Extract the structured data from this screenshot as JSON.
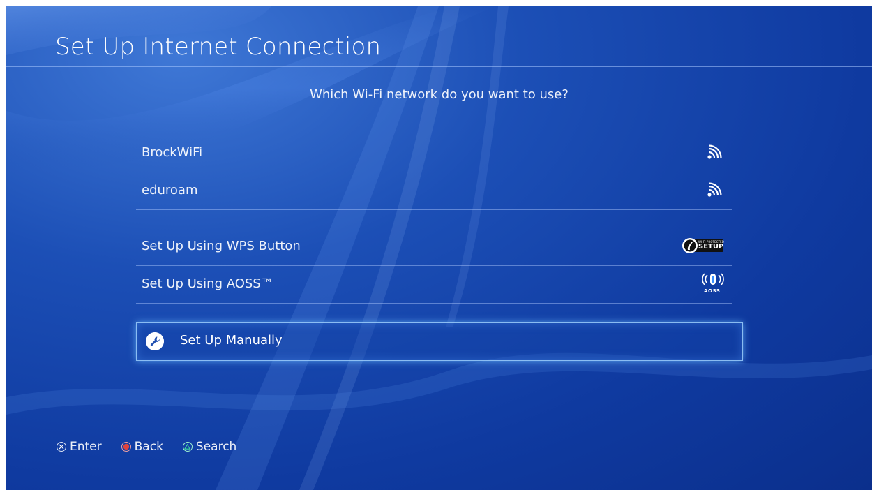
{
  "header": {
    "title": "Set Up Internet Connection"
  },
  "prompt": "Which Wi-Fi network do you want to use?",
  "networks": [
    {
      "label": "BrockWiFi",
      "icon": "wifi-signal-icon"
    },
    {
      "label": "eduroam",
      "icon": "wifi-signal-icon"
    }
  ],
  "options": [
    {
      "label": "Set Up Using WPS Button",
      "icon": "wps-setup-icon",
      "badge_small": "WI-FI PROTECTED",
      "badge_big": "SETUP"
    },
    {
      "label": "Set Up Using AOSS™",
      "icon": "aoss-icon",
      "badge": "AOSS"
    }
  ],
  "manual": {
    "label": "Set Up Manually",
    "icon": "wrench-icon"
  },
  "footer": {
    "hints": [
      {
        "button": "cross",
        "label": "Enter"
      },
      {
        "button": "circle",
        "label": "Back"
      },
      {
        "button": "triangle",
        "label": "Search"
      }
    ]
  },
  "colors": {
    "background": "#1c4fb6",
    "circle_button": "#e0433d",
    "triangle_button": "#3fd6a0",
    "highlight_border": "#a0d2ff"
  }
}
